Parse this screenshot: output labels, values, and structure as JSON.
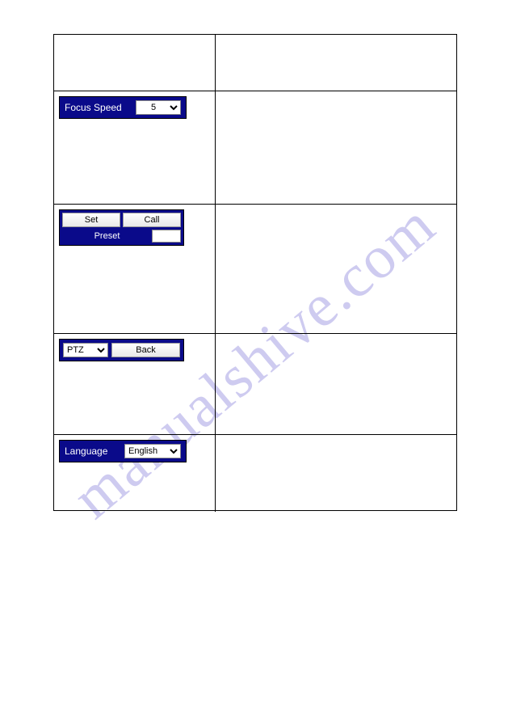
{
  "watermark": "manualshive.com",
  "focus": {
    "label": "Focus Speed",
    "value": "5"
  },
  "preset": {
    "set": "Set",
    "call": "Call",
    "label": "Preset",
    "value": ""
  },
  "ptz": {
    "mode": "PTZ",
    "back": "Back"
  },
  "language": {
    "label": "Language",
    "value": "English"
  }
}
